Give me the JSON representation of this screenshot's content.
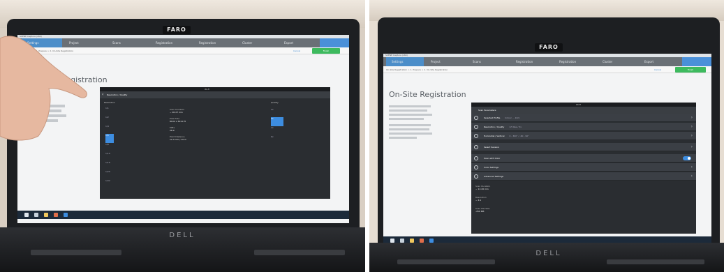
{
  "left_photo": {
    "lid_brand": "FARO",
    "laptop_brand": "DELL",
    "app": {
      "title_bar": "SCENE Capture (x64)",
      "nav_steps": [
        "Settings",
        "Project",
        "Scans",
        "Registration",
        "Registration",
        "Cluster",
        "Export"
      ],
      "breadcrumb": "Registration > 1. Prepare > 2. On-Site Registration",
      "cancel_label": "Cancel",
      "finish_label": "Finish",
      "page_title": "On-Site Registration",
      "dialog": {
        "top_center": "Wi-Fi",
        "header": "Resolution / Quality",
        "left_column_title": "Resolution",
        "resolution_options": [
          "1/1",
          "1/2",
          "1/4",
          "1/5",
          "1/8",
          "1/10",
          "1/16",
          "1/20",
          "1/32"
        ],
        "quality_title": "Quality",
        "quality_options": [
          "2x",
          "3x",
          "4x",
          "6x"
        ],
        "info": [
          {
            "label": "Scan Duration",
            "value": "~ 00:27 min"
          },
          {
            "label": "Pixel Size",
            "value": "8192 x 3414 Pt"
          },
          {
            "label": "MPts",
            "value": "28.0"
          },
          {
            "label": "Point Distance",
            "value": "12.3 mm / 10 m"
          }
        ]
      }
    }
  },
  "right_photo": {
    "lid_brand": "FARO",
    "laptop_brand": "DELL",
    "app": {
      "title_bar": "SCENE Capture (x64)",
      "nav_steps": [
        "Settings",
        "Project",
        "Scans",
        "Registration",
        "Registration",
        "Cluster",
        "Export"
      ],
      "breadcrumb": "On-Site Registration > 1. Prepare > 2. On-Site Registration",
      "cancel_label": "Cancel",
      "finish_label": "Finish",
      "page_title": "On-Site Registration",
      "dialog": {
        "top_center": "Wi-Fi",
        "header": "Scan Parameters",
        "rows": [
          {
            "label": "Selected Profile",
            "sub": "Indoor ... 10m",
            "icon": "profile-icon",
            "type": "arrow"
          },
          {
            "label": "Resolution / Quality",
            "sub": "1/5 Res / 3x",
            "icon": "resolution-icon",
            "type": "arrow"
          },
          {
            "label": "Horizontal / Vertical",
            "sub": "0 - 360° / -60 - 90°",
            "icon": "horizontal-vertical-icon",
            "type": "arrow"
          },
          {
            "label": "Select Sensors",
            "sub": "",
            "icon": "sensors-icon",
            "type": "arrow"
          },
          {
            "label": "Scan with Color",
            "sub": "",
            "icon": "color-icon",
            "type": "toggle",
            "toggle_on": true
          },
          {
            "label": "Color Settings",
            "sub": "",
            "icon": "color-settings-icon",
            "type": "arrow"
          },
          {
            "label": "Advanced Settings",
            "sub": "",
            "icon": "advanced-settings-icon",
            "type": "arrow"
          }
        ],
        "footer": [
          {
            "label": "Scan Duration",
            "value": "~ 11:20 min"
          },
          {
            "label": "Resolution",
            "value": "~ 4:1"
          },
          {
            "label": "Scan File Size",
            "value": "-250 MB"
          }
        ]
      }
    }
  },
  "colors": {
    "accent": "#4a90d9",
    "finish_green": "#3dba5e",
    "dialog_bg": "#2a2d31"
  }
}
